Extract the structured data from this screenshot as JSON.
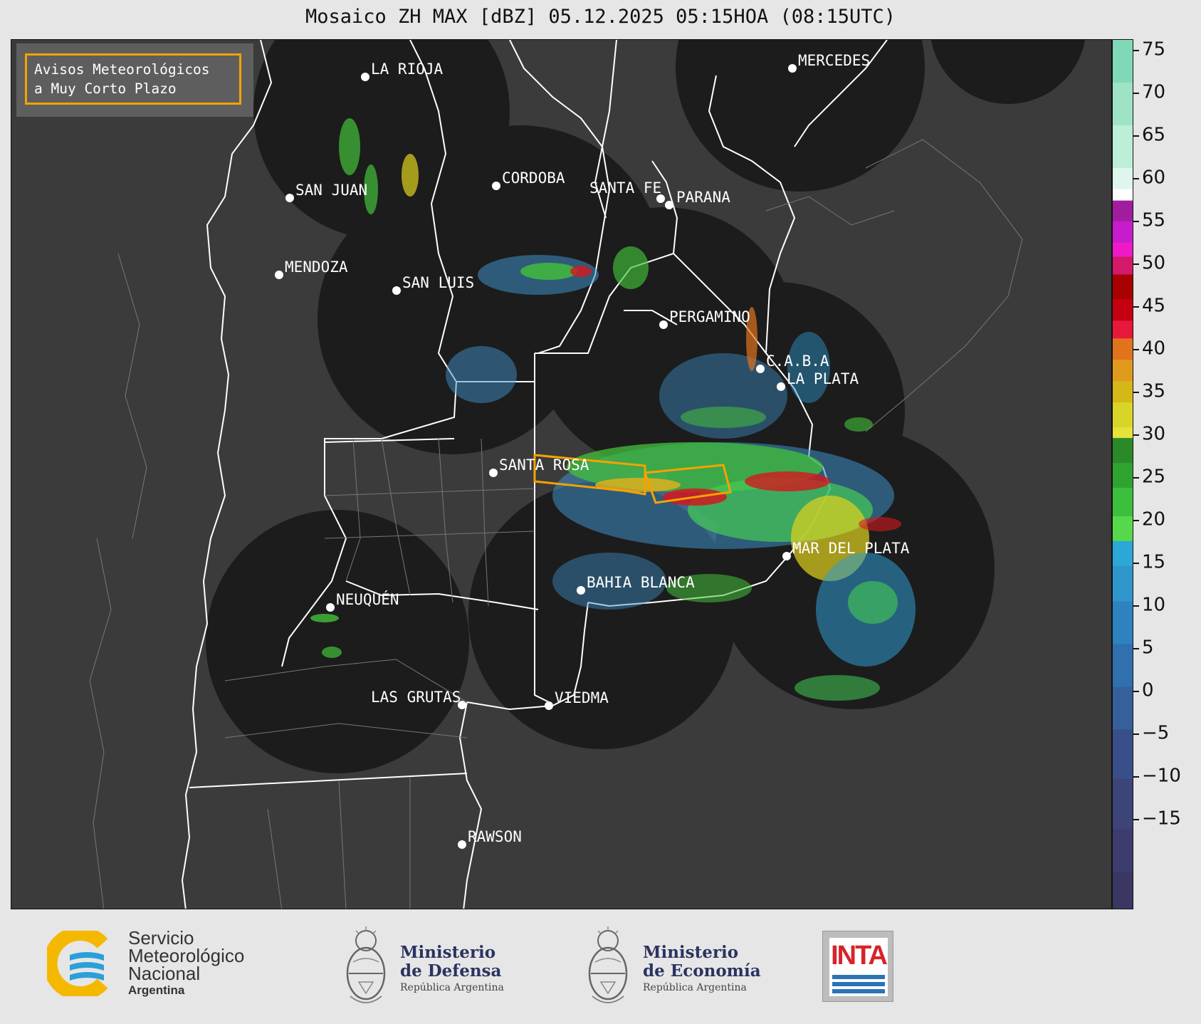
{
  "header": {
    "title": "Mosaico ZH MAX [dBZ] 05.12.2025 05:15HOA (08:15UTC)"
  },
  "warning_box": {
    "line1": "Avisos Meteorológicos",
    "line2": "a Muy Corto Plazo",
    "border_color": "#f5a300"
  },
  "cities": [
    {
      "name": "LA RIOJA"
    },
    {
      "name": "MERCEDES"
    },
    {
      "name": "SAN JUAN"
    },
    {
      "name": "CORDOBA"
    },
    {
      "name": "SANTA FE"
    },
    {
      "name": "PARANA"
    },
    {
      "name": "MENDOZA"
    },
    {
      "name": "SAN LUIS"
    },
    {
      "name": "PERGAMINO"
    },
    {
      "name": "C.A.B.A"
    },
    {
      "name": "LA PLATA"
    },
    {
      "name": "SANTA ROSA"
    },
    {
      "name": "MAR DEL PLATA"
    },
    {
      "name": "BAHIA BLANCA"
    },
    {
      "name": "NEUQUÉN"
    },
    {
      "name": "LAS GRUTAS"
    },
    {
      "name": "VIEDMA"
    },
    {
      "name": "RAWSON"
    }
  ],
  "colorbar": {
    "unit": "dBZ",
    "ticks": [
      "75",
      "70",
      "65",
      "60",
      "55",
      "50",
      "45",
      "40",
      "35",
      "30",
      "25",
      "20",
      "15",
      "10",
      "5",
      "0",
      "−5",
      "−10",
      "−15"
    ]
  },
  "logos": {
    "smn": {
      "line1": "Servicio",
      "line2": "Meteorológico",
      "line3": "Nacional",
      "line4": "Argentina"
    },
    "defensa": {
      "title1": "Ministerio",
      "title2": "de Defensa",
      "sub": "República Argentina"
    },
    "economia": {
      "title1": "Ministerio",
      "title2": "de Economía",
      "sub": "República Argentina"
    },
    "inta": {
      "text": "INTA"
    }
  }
}
